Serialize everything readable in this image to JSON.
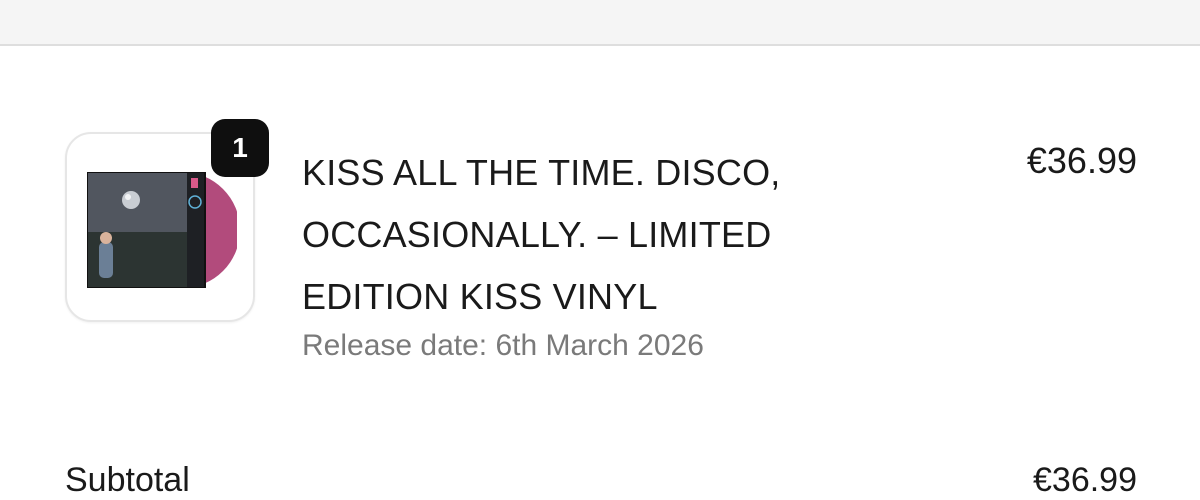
{
  "cart": {
    "items": [
      {
        "quantity": "1",
        "title_line1": "KISS ALL THE TIME. DISCO,",
        "title_line2": "OCCASIONALLY. – LIMITED",
        "title_line3": "EDITION KISS VINYL",
        "release_date": "Release date: 6th March 2026",
        "price": "€36.99",
        "image_icon": "vinyl-album-cover-image",
        "vinyl_color": "#b24b7c"
      }
    ],
    "subtotal_label": "Subtotal",
    "subtotal_value": "€36.99"
  }
}
